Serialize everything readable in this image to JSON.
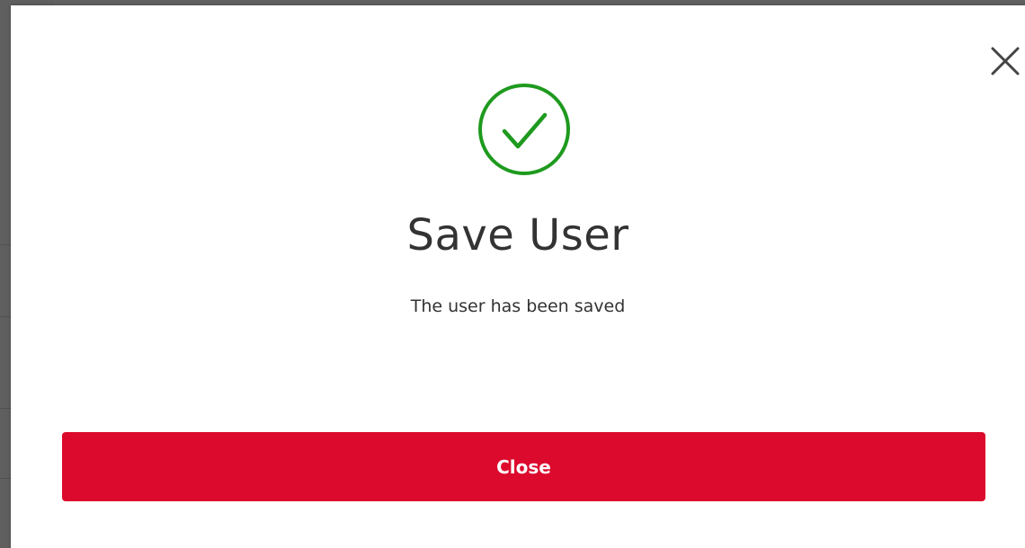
{
  "dialog": {
    "title": "Save User",
    "message": "The user has been saved",
    "close_button_label": "Close",
    "icons": {
      "success": "check-circle-icon",
      "dismiss": "close-icon"
    },
    "colors": {
      "success_green": "#1e9a1e",
      "primary_button": "#dc0a2d",
      "text": "#333333"
    }
  }
}
